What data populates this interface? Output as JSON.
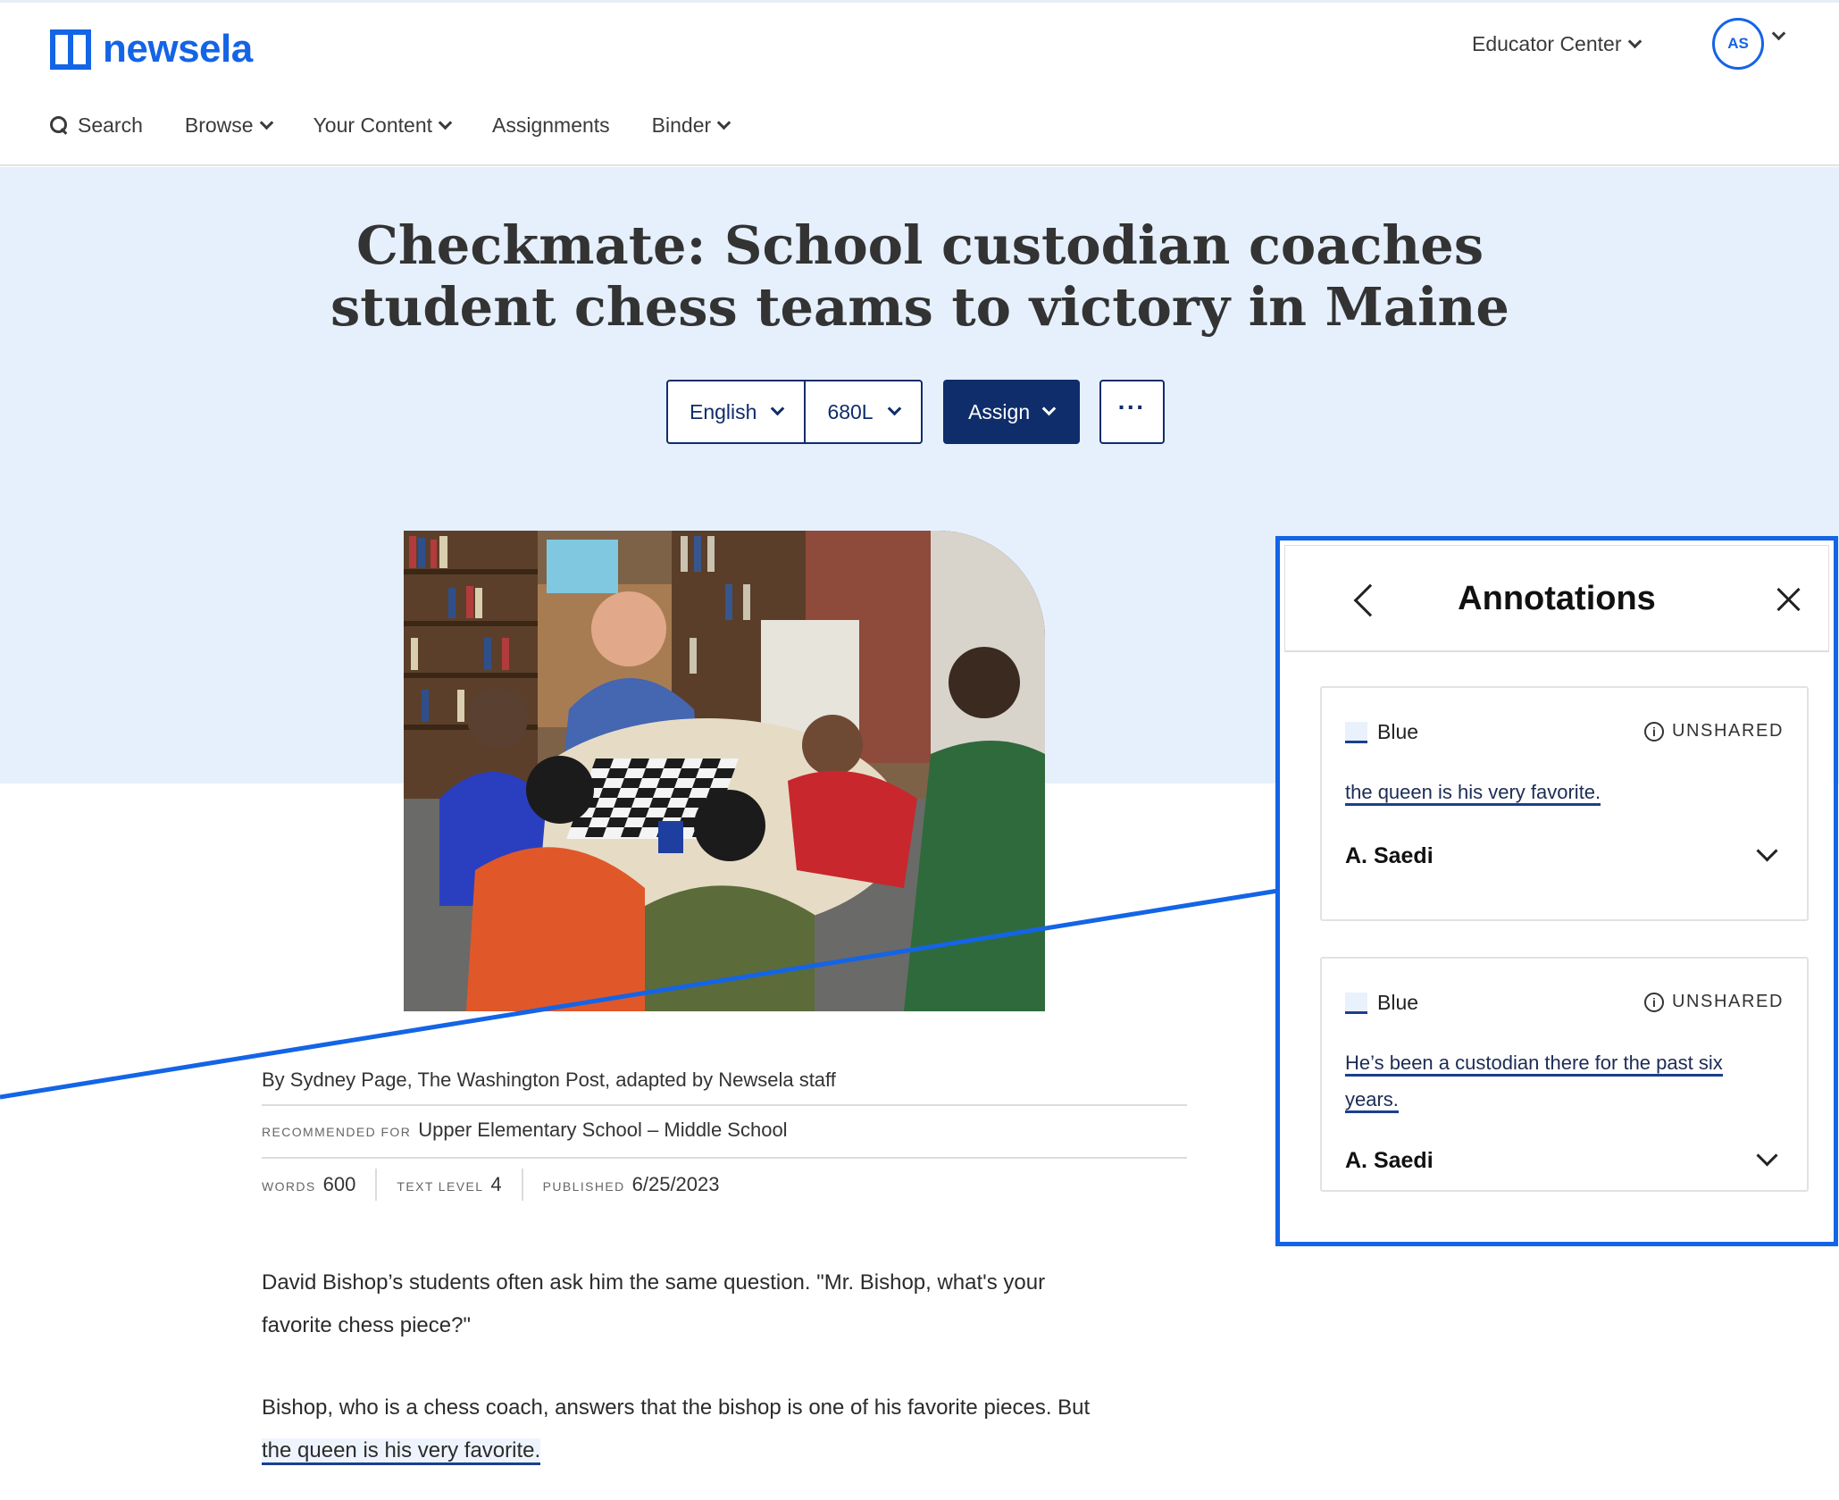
{
  "header": {
    "logo_text": "newsela",
    "educator_center": "Educator Center",
    "avatar_initials": "AS"
  },
  "nav": {
    "search": "Search",
    "browse": "Browse",
    "your_content": "Your Content",
    "assignments": "Assignments",
    "binder": "Binder"
  },
  "article": {
    "title_line1": "Checkmate: School custodian coaches",
    "title_line2": "student chess teams to victory in Maine",
    "language": "English",
    "lexile": "680L",
    "assign_label": "Assign",
    "more_label": "···",
    "byline": "By Sydney Page, The Washington Post, adapted by Newsela staff",
    "recommended_label": "Recommended for",
    "recommended_value": "Upper Elementary School – Middle School",
    "words_label": "Words",
    "words_value": "600",
    "text_level_label": "Text level",
    "text_level_value": "4",
    "published_label": "Published",
    "published_value": "6/25/2023",
    "p1_line1": "David Bishop’s students often ask him the same question. \"Mr. Bishop, what's your",
    "p1_line2": "favorite chess piece?\"",
    "p2_line1": "Bishop, who is a chess coach, answers that the bishop is one of his favorite pieces. But",
    "p2_highlight": "the queen is his very favorite."
  },
  "annotations": {
    "title": "Annotations",
    "items": [
      {
        "color": "Blue",
        "status": "UNSHARED",
        "quote_line1": "the queen is his very favorite.",
        "quote_line2": "",
        "author": "A. Saedi"
      },
      {
        "color": "Blue",
        "status": "UNSHARED",
        "quote_line1": "He’s been a custodian there for the past six",
        "quote_line2": "years.",
        "author": "A. Saedi"
      }
    ]
  },
  "colors": {
    "brand_blue": "#1464e6",
    "navy": "#0f2d6b",
    "hero_bg": "#e6f0fd",
    "highlight_underline": "#1c3f8c"
  }
}
